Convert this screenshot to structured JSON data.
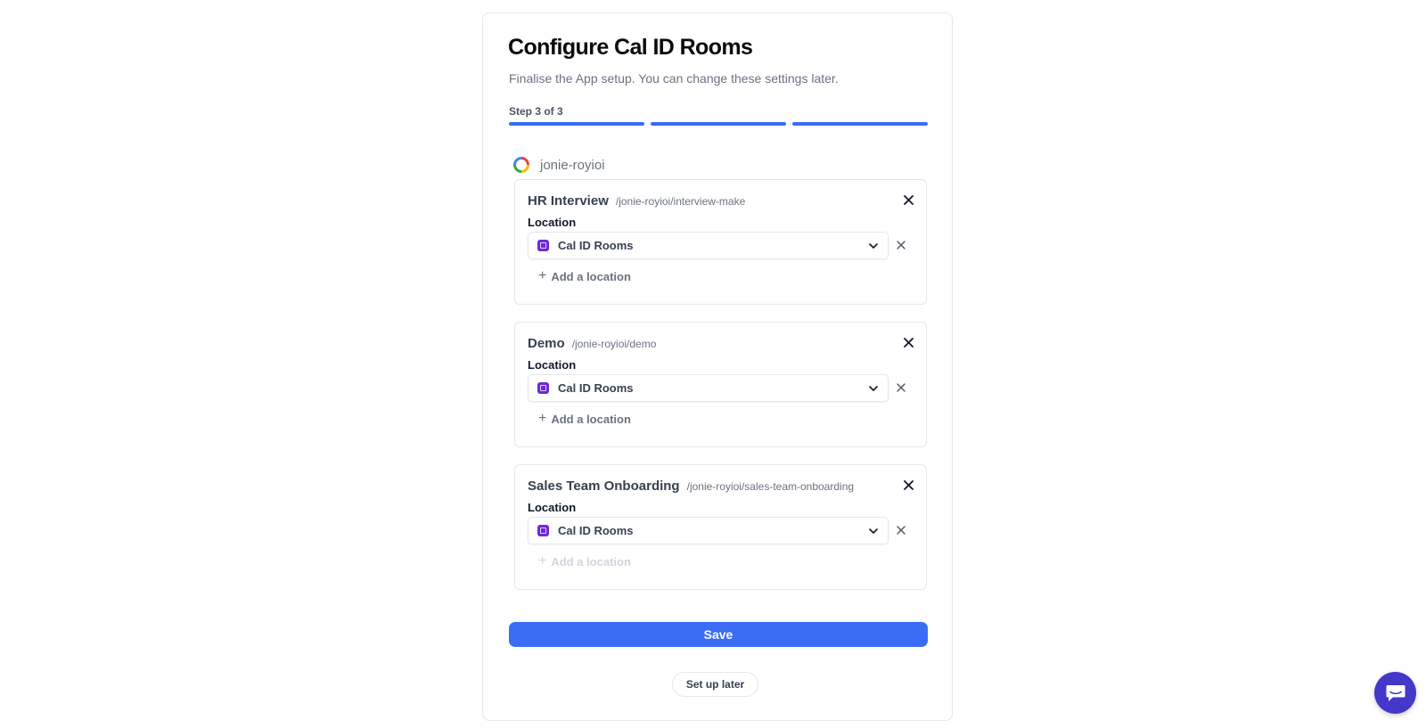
{
  "page": {
    "title": "Configure Cal ID Rooms",
    "subtitle": "Finalise the App setup. You can change these settings later.",
    "step_label": "Step 3 of 3",
    "steps_total": 3,
    "steps_completed": 3
  },
  "account": {
    "name": "jonie-royioi",
    "icon": "multicolor-ring-icon"
  },
  "labels": {
    "location": "Location",
    "add_location": "Add a location"
  },
  "event_types": [
    {
      "title": "HR Interview",
      "slug": "/jonie-royioi/interview-make",
      "location": "Cal ID Rooms",
      "add_location_enabled": true
    },
    {
      "title": "Demo",
      "slug": "/jonie-royioi/demo",
      "location": "Cal ID Rooms",
      "add_location_enabled": true
    },
    {
      "title": "Sales Team Onboarding",
      "slug": "/jonie-royioi/sales-team-onboarding",
      "location": "Cal ID Rooms",
      "add_location_enabled": false
    }
  ],
  "actions": {
    "save": "Save",
    "setup_later": "Set up later"
  },
  "colors": {
    "accent": "#3b6cf6",
    "room_icon": "#6d28d9",
    "chat": "#4338ca"
  },
  "icons": {
    "close": "close-icon",
    "chevron": "chevron-down-icon",
    "remove": "remove-location-icon",
    "plus": "plus-icon",
    "chat": "chat-icon"
  }
}
